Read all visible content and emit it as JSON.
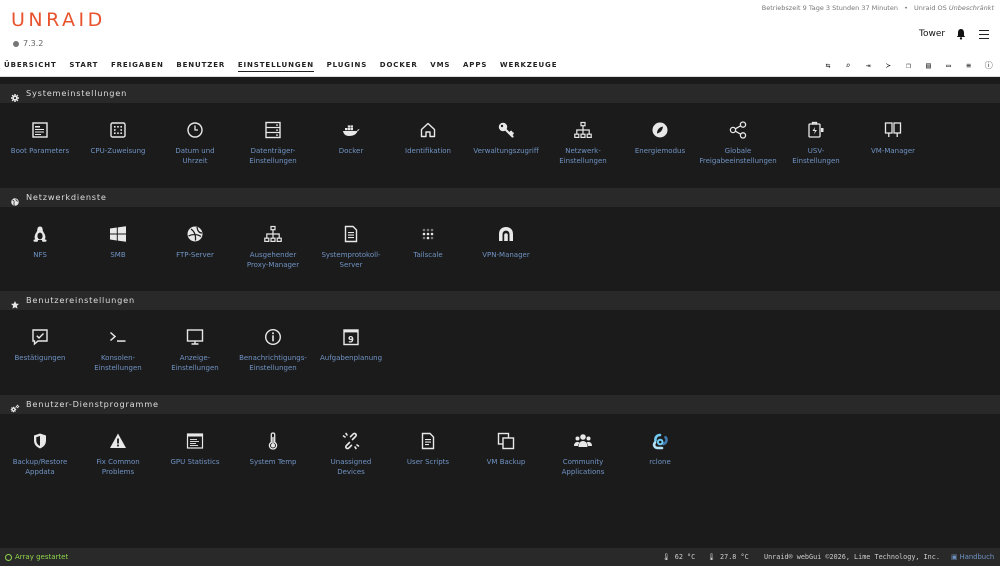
{
  "header": {
    "logo": "UNRAID",
    "version": "7.3.2",
    "uptime": "Betriebszeit 9 Tage 3 Stunden 37 Minuten",
    "sep": "•",
    "os_prefix": "Unraid OS ",
    "os_license": "Unbeschränkt",
    "server_name": "Tower"
  },
  "nav": {
    "items": [
      "ÜBERSICHT",
      "START",
      "FREIGABEN",
      "BENUTZER",
      "EINSTELLUNGEN",
      "PLUGINS",
      "DOCKER",
      "VMS",
      "APPS",
      "WERKZEUGE"
    ],
    "active": "EINSTELLUNGEN",
    "icons": [
      "swap-icon",
      "search-icon",
      "logout-icon",
      "terminal-icon",
      "copy-icon",
      "comment-icon",
      "monitor-icon",
      "list-icon",
      "info-icon"
    ]
  },
  "sections": [
    {
      "title": "Systemeinstellungen",
      "icon": "gear-icon",
      "tiles": [
        {
          "label1": "Boot Parameters",
          "label2": "",
          "icon": "boot-icon"
        },
        {
          "label1": "CPU-Zuweisung",
          "label2": "",
          "icon": "cpu-icon"
        },
        {
          "label1": "Datum und",
          "label2": "Uhrzeit",
          "icon": "clock-icon"
        },
        {
          "label1": "Datenträger-",
          "label2": "Einstellungen",
          "icon": "disk-icon"
        },
        {
          "label1": "Docker",
          "label2": "",
          "icon": "docker-icon"
        },
        {
          "label1": "Identifikation",
          "label2": "",
          "icon": "home-icon"
        },
        {
          "label1": "Verwaltungszugriff",
          "label2": "",
          "icon": "key-icon"
        },
        {
          "label1": "Netzwerk-",
          "label2": "Einstellungen",
          "icon": "network-icon"
        },
        {
          "label1": "Energiemodus",
          "label2": "",
          "icon": "leaf-icon"
        },
        {
          "label1": "Globale",
          "label2": "Freigabeeinstellungen",
          "icon": "share-icon"
        },
        {
          "label1": "USV-",
          "label2": "Einstellungen",
          "icon": "battery-icon"
        },
        {
          "label1": "VM-Manager",
          "label2": "",
          "icon": "columns-icon"
        }
      ]
    },
    {
      "title": "Netzwerkdienste",
      "icon": "globe-icon",
      "tiles": [
        {
          "label1": "NFS",
          "label2": "",
          "icon": "linux-icon"
        },
        {
          "label1": "SMB",
          "label2": "",
          "icon": "windows-icon"
        },
        {
          "label1": "FTP-Server",
          "label2": "",
          "icon": "ftp-icon"
        },
        {
          "label1": "Ausgehender",
          "label2": "Proxy-Manager",
          "icon": "sitemap-icon"
        },
        {
          "label1": "Systemprotokoll-",
          "label2": "Server",
          "icon": "file-icon"
        },
        {
          "label1": "Tailscale",
          "label2": "",
          "icon": "tailscale-icon"
        },
        {
          "label1": "VPN-Manager",
          "label2": "",
          "icon": "vpn-icon"
        }
      ]
    },
    {
      "title": "Benutzereinstellungen",
      "icon": "star-icon",
      "tiles": [
        {
          "label1": "Bestätigungen",
          "label2": "",
          "icon": "check-comment-icon"
        },
        {
          "label1": "Konsolen-",
          "label2": "Einstellungen",
          "icon": "prompt-icon"
        },
        {
          "label1": "Anzeige-",
          "label2": "Einstellungen",
          "icon": "display-icon"
        },
        {
          "label1": "Benachrichtigungs-",
          "label2": "Einstellungen",
          "icon": "info-circle-icon"
        },
        {
          "label1": "Aufgabenplanung",
          "label2": "",
          "icon": "calendar-icon"
        }
      ]
    },
    {
      "title": "Benutzer-Dienstprogramme",
      "icon": "cogs-icon",
      "tiles": [
        {
          "label1": "Backup/Restore",
          "label2": "Appdata",
          "icon": "shield-icon"
        },
        {
          "label1": "Fix Common",
          "label2": "Problems",
          "icon": "warning-icon"
        },
        {
          "label1": "GPU Statistics",
          "label2": "",
          "icon": "gpu-icon"
        },
        {
          "label1": "System Temp",
          "label2": "",
          "icon": "thermometer-icon"
        },
        {
          "label1": "Unassigned",
          "label2": "Devices",
          "icon": "unlink-icon"
        },
        {
          "label1": "User Scripts",
          "label2": "",
          "icon": "script-icon"
        },
        {
          "label1": "VM Backup",
          "label2": "",
          "icon": "backup-icon"
        },
        {
          "label1": "Community",
          "label2": "Applications",
          "icon": "users-icon"
        },
        {
          "label1": "rclone",
          "label2": "",
          "icon": "rclone-icon"
        }
      ]
    }
  ],
  "footer": {
    "array_status": "Array gestartet",
    "cpu_temp": "62 °C",
    "mb_temp": "27.8 °C",
    "copyright": "Unraid® webGui ©2026, Lime Technology, Inc.",
    "manual": "Handbuch"
  },
  "colors": {
    "accent": "#e8532e",
    "link": "#6f93c4",
    "status_ok": "#8ed54a"
  }
}
